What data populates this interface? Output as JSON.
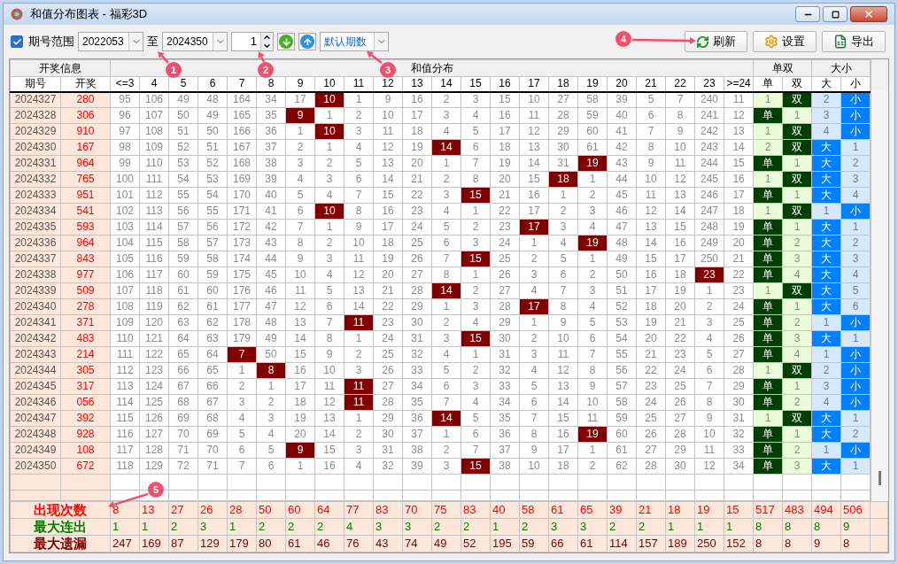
{
  "window": {
    "title": "和值分布图表 - 福彩3D"
  },
  "toolbar": {
    "range": {
      "label": "期号范围",
      "checked": true
    },
    "from": "2022053",
    "to_label": "至",
    "to": "2024350",
    "step": "1",
    "preset": "默认期数",
    "buttons": [
      {
        "label": "刷新",
        "kind": "refresh"
      },
      {
        "label": "设置",
        "kind": "settings"
      },
      {
        "label": "导出",
        "kind": "export"
      }
    ]
  },
  "table": {
    "groups": [
      {
        "label": "开奖信息",
        "columns": [
          "期号",
          "开奖"
        ]
      },
      {
        "label": "和值分布",
        "columns": [
          "<=3",
          "4",
          "5",
          "6",
          "7",
          "8",
          "9",
          "10",
          "11",
          "12",
          "13",
          "14",
          "15",
          "16",
          "17",
          "18",
          "19",
          "20",
          "21",
          "22",
          "23",
          ">=24"
        ]
      },
      {
        "label": "单双",
        "columns": [
          "单",
          "双"
        ]
      },
      {
        "label": "大小",
        "columns": [
          "大",
          "小"
        ]
      }
    ],
    "rows": [
      {
        "period": "2024327",
        "draw": "280",
        "sums": [
          "95",
          "106",
          "49",
          "48",
          "164",
          "34",
          "17",
          "10",
          "1",
          "9",
          "16",
          "2",
          "3",
          "15",
          "10",
          "27",
          "58",
          "39",
          "5",
          "7",
          "240",
          "11"
        ],
        "hits": [
          false,
          false,
          false,
          false,
          false,
          false,
          false,
          true,
          false,
          false,
          false,
          false,
          false,
          false,
          false,
          false,
          false,
          false,
          false,
          false,
          false,
          false
        ],
        "parity": [
          {
            "text": "1",
            "hit": false
          },
          {
            "text": "双",
            "hit": true
          }
        ],
        "size": [
          {
            "text": "2",
            "hit": false
          },
          {
            "text": "小",
            "hit": true
          }
        ]
      },
      {
        "period": "2024328",
        "draw": "306",
        "sums": [
          "96",
          "107",
          "50",
          "49",
          "165",
          "35",
          "9",
          "1",
          "2",
          "10",
          "17",
          "3",
          "4",
          "16",
          "11",
          "28",
          "59",
          "40",
          "6",
          "8",
          "241",
          "12"
        ],
        "hits": [
          false,
          false,
          false,
          false,
          false,
          false,
          true,
          false,
          false,
          false,
          false,
          false,
          false,
          false,
          false,
          false,
          false,
          false,
          false,
          false,
          false,
          false
        ],
        "parity": [
          {
            "text": "单",
            "hit": true
          },
          {
            "text": "1",
            "hit": false
          }
        ],
        "size": [
          {
            "text": "3",
            "hit": false
          },
          {
            "text": "小",
            "hit": true
          }
        ]
      },
      {
        "period": "2024329",
        "draw": "910",
        "sums": [
          "97",
          "108",
          "51",
          "50",
          "166",
          "36",
          "1",
          "10",
          "3",
          "11",
          "18",
          "4",
          "5",
          "17",
          "12",
          "29",
          "60",
          "41",
          "7",
          "9",
          "242",
          "13"
        ],
        "hits": [
          false,
          false,
          false,
          false,
          false,
          false,
          false,
          true,
          false,
          false,
          false,
          false,
          false,
          false,
          false,
          false,
          false,
          false,
          false,
          false,
          false,
          false
        ],
        "parity": [
          {
            "text": "1",
            "hit": false
          },
          {
            "text": "双",
            "hit": true
          }
        ],
        "size": [
          {
            "text": "4",
            "hit": false
          },
          {
            "text": "小",
            "hit": true
          }
        ]
      },
      {
        "period": "2024330",
        "draw": "167",
        "sums": [
          "98",
          "109",
          "52",
          "51",
          "167",
          "37",
          "2",
          "1",
          "4",
          "12",
          "19",
          "14",
          "6",
          "18",
          "13",
          "30",
          "61",
          "42",
          "8",
          "10",
          "243",
          "14"
        ],
        "hits": [
          false,
          false,
          false,
          false,
          false,
          false,
          false,
          false,
          false,
          false,
          false,
          true,
          false,
          false,
          false,
          false,
          false,
          false,
          false,
          false,
          false,
          false
        ],
        "parity": [
          {
            "text": "2",
            "hit": false
          },
          {
            "text": "双",
            "hit": true
          }
        ],
        "size": [
          {
            "text": "大",
            "hit": true
          },
          {
            "text": "1",
            "hit": false
          }
        ]
      },
      {
        "period": "2024331",
        "draw": "964",
        "sums": [
          "99",
          "110",
          "53",
          "52",
          "168",
          "38",
          "3",
          "2",
          "5",
          "13",
          "20",
          "1",
          "7",
          "19",
          "14",
          "31",
          "19",
          "43",
          "9",
          "11",
          "244",
          "15"
        ],
        "hits": [
          false,
          false,
          false,
          false,
          false,
          false,
          false,
          false,
          false,
          false,
          false,
          false,
          false,
          false,
          false,
          false,
          true,
          false,
          false,
          false,
          false,
          false
        ],
        "parity": [
          {
            "text": "单",
            "hit": true
          },
          {
            "text": "1",
            "hit": false
          }
        ],
        "size": [
          {
            "text": "大",
            "hit": true
          },
          {
            "text": "2",
            "hit": false
          }
        ]
      },
      {
        "period": "2024332",
        "draw": "765",
        "sums": [
          "100",
          "111",
          "54",
          "53",
          "169",
          "39",
          "4",
          "3",
          "6",
          "14",
          "21",
          "2",
          "8",
          "20",
          "15",
          "18",
          "1",
          "44",
          "10",
          "12",
          "245",
          "16"
        ],
        "hits": [
          false,
          false,
          false,
          false,
          false,
          false,
          false,
          false,
          false,
          false,
          false,
          false,
          false,
          false,
          false,
          true,
          false,
          false,
          false,
          false,
          false,
          false
        ],
        "parity": [
          {
            "text": "1",
            "hit": false
          },
          {
            "text": "双",
            "hit": true
          }
        ],
        "size": [
          {
            "text": "大",
            "hit": true
          },
          {
            "text": "3",
            "hit": false
          }
        ]
      },
      {
        "period": "2024333",
        "draw": "951",
        "sums": [
          "101",
          "112",
          "55",
          "54",
          "170",
          "40",
          "5",
          "4",
          "7",
          "15",
          "22",
          "3",
          "15",
          "21",
          "16",
          "1",
          "2",
          "45",
          "11",
          "13",
          "246",
          "17"
        ],
        "hits": [
          false,
          false,
          false,
          false,
          false,
          false,
          false,
          false,
          false,
          false,
          false,
          false,
          true,
          false,
          false,
          false,
          false,
          false,
          false,
          false,
          false,
          false
        ],
        "parity": [
          {
            "text": "单",
            "hit": true
          },
          {
            "text": "1",
            "hit": false
          }
        ],
        "size": [
          {
            "text": "大",
            "hit": true
          },
          {
            "text": "4",
            "hit": false
          }
        ]
      },
      {
        "period": "2024334",
        "draw": "541",
        "sums": [
          "102",
          "113",
          "56",
          "55",
          "171",
          "41",
          "6",
          "10",
          "8",
          "16",
          "23",
          "4",
          "1",
          "22",
          "17",
          "2",
          "3",
          "46",
          "12",
          "14",
          "247",
          "18"
        ],
        "hits": [
          false,
          false,
          false,
          false,
          false,
          false,
          false,
          true,
          false,
          false,
          false,
          false,
          false,
          false,
          false,
          false,
          false,
          false,
          false,
          false,
          false,
          false
        ],
        "parity": [
          {
            "text": "1",
            "hit": false
          },
          {
            "text": "双",
            "hit": true
          }
        ],
        "size": [
          {
            "text": "1",
            "hit": false
          },
          {
            "text": "小",
            "hit": true
          }
        ]
      },
      {
        "period": "2024335",
        "draw": "593",
        "sums": [
          "103",
          "114",
          "57",
          "56",
          "172",
          "42",
          "7",
          "1",
          "9",
          "17",
          "24",
          "5",
          "2",
          "23",
          "17",
          "3",
          "4",
          "47",
          "13",
          "15",
          "248",
          "19"
        ],
        "hits": [
          false,
          false,
          false,
          false,
          false,
          false,
          false,
          false,
          false,
          false,
          false,
          false,
          false,
          false,
          true,
          false,
          false,
          false,
          false,
          false,
          false,
          false
        ],
        "parity": [
          {
            "text": "单",
            "hit": true
          },
          {
            "text": "1",
            "hit": false
          }
        ],
        "size": [
          {
            "text": "大",
            "hit": true
          },
          {
            "text": "1",
            "hit": false
          }
        ]
      },
      {
        "period": "2024336",
        "draw": "964",
        "sums": [
          "104",
          "115",
          "58",
          "57",
          "173",
          "43",
          "8",
          "2",
          "10",
          "18",
          "25",
          "6",
          "3",
          "24",
          "1",
          "4",
          "19",
          "48",
          "14",
          "16",
          "249",
          "20"
        ],
        "hits": [
          false,
          false,
          false,
          false,
          false,
          false,
          false,
          false,
          false,
          false,
          false,
          false,
          false,
          false,
          false,
          false,
          true,
          false,
          false,
          false,
          false,
          false
        ],
        "parity": [
          {
            "text": "单",
            "hit": true
          },
          {
            "text": "2",
            "hit": false
          }
        ],
        "size": [
          {
            "text": "大",
            "hit": true
          },
          {
            "text": "2",
            "hit": false
          }
        ]
      },
      {
        "period": "2024337",
        "draw": "843",
        "sums": [
          "105",
          "116",
          "59",
          "58",
          "174",
          "44",
          "9",
          "3",
          "11",
          "19",
          "26",
          "7",
          "15",
          "25",
          "2",
          "5",
          "1",
          "49",
          "15",
          "17",
          "250",
          "21"
        ],
        "hits": [
          false,
          false,
          false,
          false,
          false,
          false,
          false,
          false,
          false,
          false,
          false,
          false,
          true,
          false,
          false,
          false,
          false,
          false,
          false,
          false,
          false,
          false
        ],
        "parity": [
          {
            "text": "单",
            "hit": true
          },
          {
            "text": "3",
            "hit": false
          }
        ],
        "size": [
          {
            "text": "大",
            "hit": true
          },
          {
            "text": "3",
            "hit": false
          }
        ]
      },
      {
        "period": "2024338",
        "draw": "977",
        "sums": [
          "106",
          "117",
          "60",
          "59",
          "175",
          "45",
          "10",
          "4",
          "12",
          "20",
          "27",
          "8",
          "1",
          "26",
          "3",
          "6",
          "2",
          "50",
          "16",
          "18",
          "23",
          "22"
        ],
        "hits": [
          false,
          false,
          false,
          false,
          false,
          false,
          false,
          false,
          false,
          false,
          false,
          false,
          false,
          false,
          false,
          false,
          false,
          false,
          false,
          false,
          true,
          false
        ],
        "parity": [
          {
            "text": "单",
            "hit": true
          },
          {
            "text": "4",
            "hit": false
          }
        ],
        "size": [
          {
            "text": "大",
            "hit": true
          },
          {
            "text": "4",
            "hit": false
          }
        ]
      },
      {
        "period": "2024339",
        "draw": "509",
        "sums": [
          "107",
          "118",
          "61",
          "60",
          "176",
          "46",
          "11",
          "5",
          "13",
          "21",
          "28",
          "14",
          "2",
          "27",
          "4",
          "7",
          "3",
          "51",
          "17",
          "19",
          "1",
          "23"
        ],
        "hits": [
          false,
          false,
          false,
          false,
          false,
          false,
          false,
          false,
          false,
          false,
          false,
          true,
          false,
          false,
          false,
          false,
          false,
          false,
          false,
          false,
          false,
          false
        ],
        "parity": [
          {
            "text": "1",
            "hit": false
          },
          {
            "text": "双",
            "hit": true
          }
        ],
        "size": [
          {
            "text": "大",
            "hit": true
          },
          {
            "text": "5",
            "hit": false
          }
        ]
      },
      {
        "period": "2024340",
        "draw": "278",
        "sums": [
          "108",
          "119",
          "62",
          "61",
          "177",
          "47",
          "12",
          "6",
          "14",
          "22",
          "29",
          "1",
          "3",
          "28",
          "17",
          "8",
          "4",
          "52",
          "18",
          "20",
          "2",
          "24"
        ],
        "hits": [
          false,
          false,
          false,
          false,
          false,
          false,
          false,
          false,
          false,
          false,
          false,
          false,
          false,
          false,
          true,
          false,
          false,
          false,
          false,
          false,
          false,
          false
        ],
        "parity": [
          {
            "text": "单",
            "hit": true
          },
          {
            "text": "1",
            "hit": false
          }
        ],
        "size": [
          {
            "text": "大",
            "hit": true
          },
          {
            "text": "6",
            "hit": false
          }
        ]
      },
      {
        "period": "2024341",
        "draw": "371",
        "sums": [
          "109",
          "120",
          "63",
          "62",
          "178",
          "48",
          "13",
          "7",
          "11",
          "23",
          "30",
          "2",
          "4",
          "29",
          "1",
          "9",
          "5",
          "53",
          "19",
          "21",
          "3",
          "25"
        ],
        "hits": [
          false,
          false,
          false,
          false,
          false,
          false,
          false,
          false,
          true,
          false,
          false,
          false,
          false,
          false,
          false,
          false,
          false,
          false,
          false,
          false,
          false,
          false
        ],
        "parity": [
          {
            "text": "单",
            "hit": true
          },
          {
            "text": "2",
            "hit": false
          }
        ],
        "size": [
          {
            "text": "1",
            "hit": false
          },
          {
            "text": "小",
            "hit": true
          }
        ]
      },
      {
        "period": "2024342",
        "draw": "483",
        "sums": [
          "110",
          "121",
          "64",
          "63",
          "179",
          "49",
          "14",
          "8",
          "1",
          "24",
          "31",
          "3",
          "15",
          "30",
          "2",
          "10",
          "6",
          "54",
          "20",
          "22",
          "4",
          "26"
        ],
        "hits": [
          false,
          false,
          false,
          false,
          false,
          false,
          false,
          false,
          false,
          false,
          false,
          false,
          true,
          false,
          false,
          false,
          false,
          false,
          false,
          false,
          false,
          false
        ],
        "parity": [
          {
            "text": "单",
            "hit": true
          },
          {
            "text": "3",
            "hit": false
          }
        ],
        "size": [
          {
            "text": "大",
            "hit": true
          },
          {
            "text": "1",
            "hit": false
          }
        ]
      },
      {
        "period": "2024343",
        "draw": "214",
        "sums": [
          "111",
          "122",
          "65",
          "64",
          "7",
          "50",
          "15",
          "9",
          "2",
          "25",
          "32",
          "4",
          "1",
          "31",
          "3",
          "11",
          "7",
          "55",
          "21",
          "23",
          "5",
          "27"
        ],
        "hits": [
          false,
          false,
          false,
          false,
          true,
          false,
          false,
          false,
          false,
          false,
          false,
          false,
          false,
          false,
          false,
          false,
          false,
          false,
          false,
          false,
          false,
          false
        ],
        "parity": [
          {
            "text": "单",
            "hit": true
          },
          {
            "text": "4",
            "hit": false
          }
        ],
        "size": [
          {
            "text": "1",
            "hit": false
          },
          {
            "text": "小",
            "hit": true
          }
        ]
      },
      {
        "period": "2024344",
        "draw": "305",
        "sums": [
          "112",
          "123",
          "66",
          "65",
          "1",
          "8",
          "16",
          "10",
          "3",
          "26",
          "33",
          "5",
          "2",
          "32",
          "4",
          "12",
          "8",
          "56",
          "22",
          "24",
          "6",
          "28"
        ],
        "hits": [
          false,
          false,
          false,
          false,
          false,
          true,
          false,
          false,
          false,
          false,
          false,
          false,
          false,
          false,
          false,
          false,
          false,
          false,
          false,
          false,
          false,
          false
        ],
        "parity": [
          {
            "text": "1",
            "hit": false
          },
          {
            "text": "双",
            "hit": true
          }
        ],
        "size": [
          {
            "text": "2",
            "hit": false
          },
          {
            "text": "小",
            "hit": true
          }
        ]
      },
      {
        "period": "2024345",
        "draw": "317",
        "sums": [
          "113",
          "124",
          "67",
          "66",
          "2",
          "1",
          "17",
          "11",
          "11",
          "27",
          "34",
          "6",
          "3",
          "33",
          "5",
          "13",
          "9",
          "57",
          "23",
          "25",
          "7",
          "29"
        ],
        "hits": [
          false,
          false,
          false,
          false,
          false,
          false,
          false,
          false,
          true,
          false,
          false,
          false,
          false,
          false,
          false,
          false,
          false,
          false,
          false,
          false,
          false,
          false
        ],
        "parity": [
          {
            "text": "单",
            "hit": true
          },
          {
            "text": "1",
            "hit": false
          }
        ],
        "size": [
          {
            "text": "3",
            "hit": false
          },
          {
            "text": "小",
            "hit": true
          }
        ]
      },
      {
        "period": "2024346",
        "draw": "056",
        "sums": [
          "114",
          "125",
          "68",
          "67",
          "3",
          "2",
          "18",
          "12",
          "11",
          "28",
          "35",
          "7",
          "4",
          "34",
          "6",
          "14",
          "10",
          "58",
          "24",
          "26",
          "8",
          "30"
        ],
        "hits": [
          false,
          false,
          false,
          false,
          false,
          false,
          false,
          false,
          true,
          false,
          false,
          false,
          false,
          false,
          false,
          false,
          false,
          false,
          false,
          false,
          false,
          false
        ],
        "parity": [
          {
            "text": "单",
            "hit": true
          },
          {
            "text": "2",
            "hit": false
          }
        ],
        "size": [
          {
            "text": "4",
            "hit": false
          },
          {
            "text": "小",
            "hit": true
          }
        ]
      },
      {
        "period": "2024347",
        "draw": "392",
        "sums": [
          "115",
          "126",
          "69",
          "68",
          "4",
          "3",
          "19",
          "13",
          "1",
          "29",
          "36",
          "14",
          "5",
          "35",
          "7",
          "15",
          "11",
          "59",
          "25",
          "27",
          "9",
          "31"
        ],
        "hits": [
          false,
          false,
          false,
          false,
          false,
          false,
          false,
          false,
          false,
          false,
          false,
          true,
          false,
          false,
          false,
          false,
          false,
          false,
          false,
          false,
          false,
          false
        ],
        "parity": [
          {
            "text": "1",
            "hit": false
          },
          {
            "text": "双",
            "hit": true
          }
        ],
        "size": [
          {
            "text": "大",
            "hit": true
          },
          {
            "text": "1",
            "hit": false
          }
        ]
      },
      {
        "period": "2024348",
        "draw": "928",
        "sums": [
          "116",
          "127",
          "70",
          "69",
          "5",
          "4",
          "20",
          "14",
          "2",
          "30",
          "37",
          "1",
          "6",
          "36",
          "8",
          "16",
          "19",
          "60",
          "26",
          "28",
          "10",
          "32"
        ],
        "hits": [
          false,
          false,
          false,
          false,
          false,
          false,
          false,
          false,
          false,
          false,
          false,
          false,
          false,
          false,
          false,
          false,
          true,
          false,
          false,
          false,
          false,
          false
        ],
        "parity": [
          {
            "text": "单",
            "hit": true
          },
          {
            "text": "1",
            "hit": false
          }
        ],
        "size": [
          {
            "text": "大",
            "hit": true
          },
          {
            "text": "2",
            "hit": false
          }
        ]
      },
      {
        "period": "2024349",
        "draw": "108",
        "sums": [
          "117",
          "128",
          "71",
          "70",
          "6",
          "5",
          "9",
          "15",
          "3",
          "31",
          "38",
          "2",
          "7",
          "37",
          "9",
          "17",
          "1",
          "61",
          "27",
          "29",
          "11",
          "33"
        ],
        "hits": [
          false,
          false,
          false,
          false,
          false,
          false,
          true,
          false,
          false,
          false,
          false,
          false,
          false,
          false,
          false,
          false,
          false,
          false,
          false,
          false,
          false,
          false
        ],
        "parity": [
          {
            "text": "单",
            "hit": true
          },
          {
            "text": "2",
            "hit": false
          }
        ],
        "size": [
          {
            "text": "1",
            "hit": false
          },
          {
            "text": "小",
            "hit": true
          }
        ]
      },
      {
        "period": "2024350",
        "draw": "672",
        "sums": [
          "118",
          "129",
          "72",
          "71",
          "7",
          "6",
          "1",
          "16",
          "4",
          "32",
          "39",
          "3",
          "15",
          "38",
          "10",
          "18",
          "2",
          "62",
          "28",
          "30",
          "12",
          "34"
        ],
        "hits": [
          false,
          false,
          false,
          false,
          false,
          false,
          false,
          false,
          false,
          false,
          false,
          false,
          true,
          false,
          false,
          false,
          false,
          false,
          false,
          false,
          false,
          false
        ],
        "parity": [
          {
            "text": "单",
            "hit": true
          },
          {
            "text": "3",
            "hit": false
          }
        ],
        "size": [
          {
            "text": "大",
            "hit": true
          },
          {
            "text": "1",
            "hit": false
          }
        ]
      }
    ],
    "summary": [
      {
        "label": "出现次数",
        "color": "#ff0000",
        "values": [
          "8",
          "13",
          "27",
          "26",
          "28",
          "50",
          "60",
          "64",
          "77",
          "83",
          "70",
          "75",
          "83",
          "40",
          "58",
          "61",
          "65",
          "39",
          "21",
          "18",
          "19",
          "15",
          "517",
          "483",
          "494",
          "506"
        ]
      },
      {
        "label": "最大连出",
        "color": "#008000",
        "values": [
          "1",
          "1",
          "2",
          "3",
          "1",
          "2",
          "2",
          "2",
          "4",
          "3",
          "3",
          "2",
          "2",
          "1",
          "2",
          "3",
          "3",
          "2",
          "2",
          "1",
          "1",
          "1",
          "8",
          "8",
          "8",
          "9"
        ]
      },
      {
        "label": "最大遗漏",
        "color": "#800000",
        "values": [
          "247",
          "169",
          "87",
          "129",
          "179",
          "80",
          "61",
          "46",
          "76",
          "43",
          "74",
          "49",
          "52",
          "195",
          "59",
          "66",
          "61",
          "114",
          "157",
          "189",
          "250",
          "152",
          "8",
          "8",
          "9",
          "8"
        ]
      }
    ]
  },
  "callouts": [
    "1",
    "2",
    "3",
    "4",
    "5"
  ]
}
